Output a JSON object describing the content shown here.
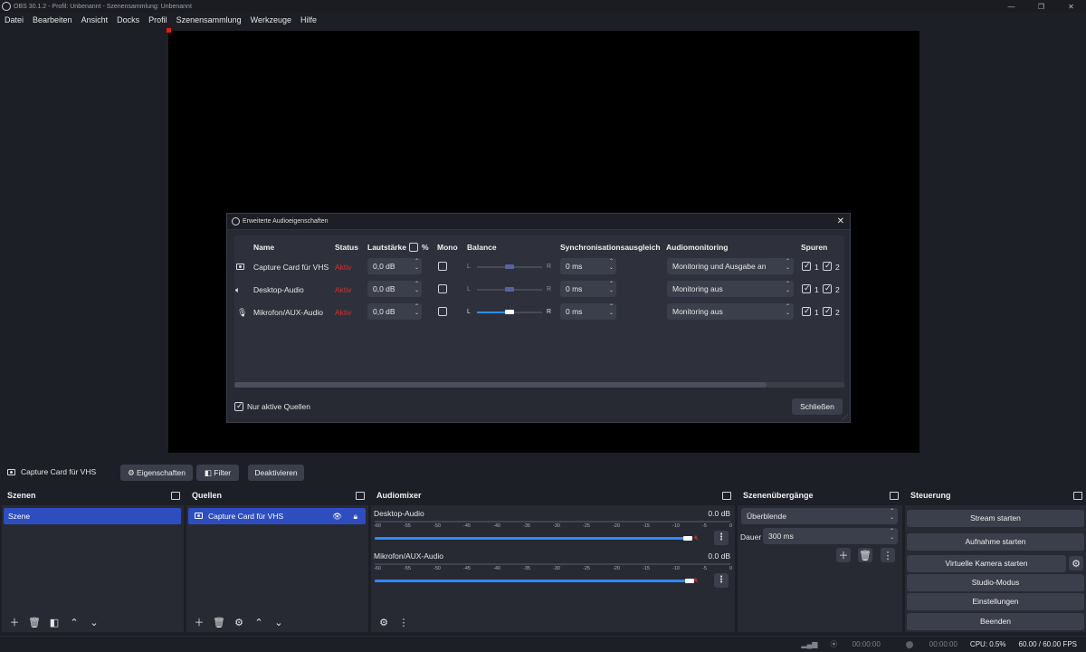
{
  "window": {
    "title": "OBS 30.1.2 - Profil: Unbenannt - Szenensammlung: Unbenannt",
    "minimize": "—",
    "maximize": "❐",
    "close": "✕"
  },
  "menu": [
    "Datei",
    "Bearbeiten",
    "Ansicht",
    "Docks",
    "Profil",
    "Szenensammlung",
    "Werkzeuge",
    "Hilfe"
  ],
  "dialog": {
    "title": "Erweiterte Audioeigenschaften",
    "columns": {
      "name": "Name",
      "status": "Status",
      "volume": "Lautstärke",
      "percent": "%",
      "mono": "Mono",
      "balance": "Balance",
      "sync": "Synchronisationsausgleich",
      "monitoring": "Audiomonitoring",
      "tracks": "Spuren"
    },
    "balance_left": "L",
    "balance_right": "R",
    "rows": [
      {
        "icon": "camera-icon",
        "name": "Capture Card für VHS",
        "status": "Aktiv",
        "volume": "0,0 dB",
        "mono": false,
        "sync": "0 ms",
        "monitoring": "Monitoring und Ausgabe an",
        "track1": "1",
        "track2": "2"
      },
      {
        "icon": "speaker-icon",
        "name": "Desktop-Audio",
        "status": "Aktiv",
        "volume": "0,0 dB",
        "mono": false,
        "sync": "0 ms",
        "monitoring": "Monitoring aus",
        "track1": "1",
        "track2": "2"
      },
      {
        "icon": "microphone-icon",
        "name": "Mikrofon/AUX-Audio",
        "status": "Aktiv",
        "volume": "0,0 dB",
        "mono": false,
        "sync": "0 ms",
        "monitoring": "Monitoring aus",
        "track1": "1",
        "track2": "2"
      }
    ],
    "only_active_label": "Nur aktive Quellen",
    "close_button": "Schließen"
  },
  "context": {
    "source": "Capture Card für VHS",
    "properties": "Eigenschaften",
    "filters": "Filter",
    "deactivate": "Deaktivieren"
  },
  "scenes": {
    "title": "Szenen",
    "items": [
      "Szene"
    ]
  },
  "sources": {
    "title": "Quellen",
    "items": [
      "Capture Card für VHS"
    ]
  },
  "mixer": {
    "title": "Audiomixer",
    "ticks": [
      "-60",
      "-55",
      "-50",
      "-45",
      "-40",
      "-35",
      "-30",
      "-25",
      "-20",
      "-15",
      "-10",
      "-5",
      "0"
    ],
    "channels": [
      {
        "name": "Desktop-Audio",
        "db": "0.0 dB"
      },
      {
        "name": "Mikrofon/AUX-Audio",
        "db": "0.0 dB"
      }
    ]
  },
  "transitions": {
    "title": "Szenenübergänge",
    "selected": "Überblende",
    "duration_label": "Dauer",
    "duration": "300 ms"
  },
  "controls": {
    "title": "Steuerung",
    "stream": "Stream starten",
    "record": "Aufnahme starten",
    "virtual_cam": "Virtuelle Kamera starten",
    "studio": "Studio-Modus",
    "settings": "Einstellungen",
    "exit": "Beenden"
  },
  "status": {
    "stream_time": "00:00:00",
    "record_time": "00:00:00",
    "cpu": "CPU: 0.5%",
    "fps": "60.00 / 60.00 FPS"
  },
  "colors": {
    "accent": "#2e4dbf",
    "status_active": "#d13030",
    "slider": "#2f8aff"
  }
}
